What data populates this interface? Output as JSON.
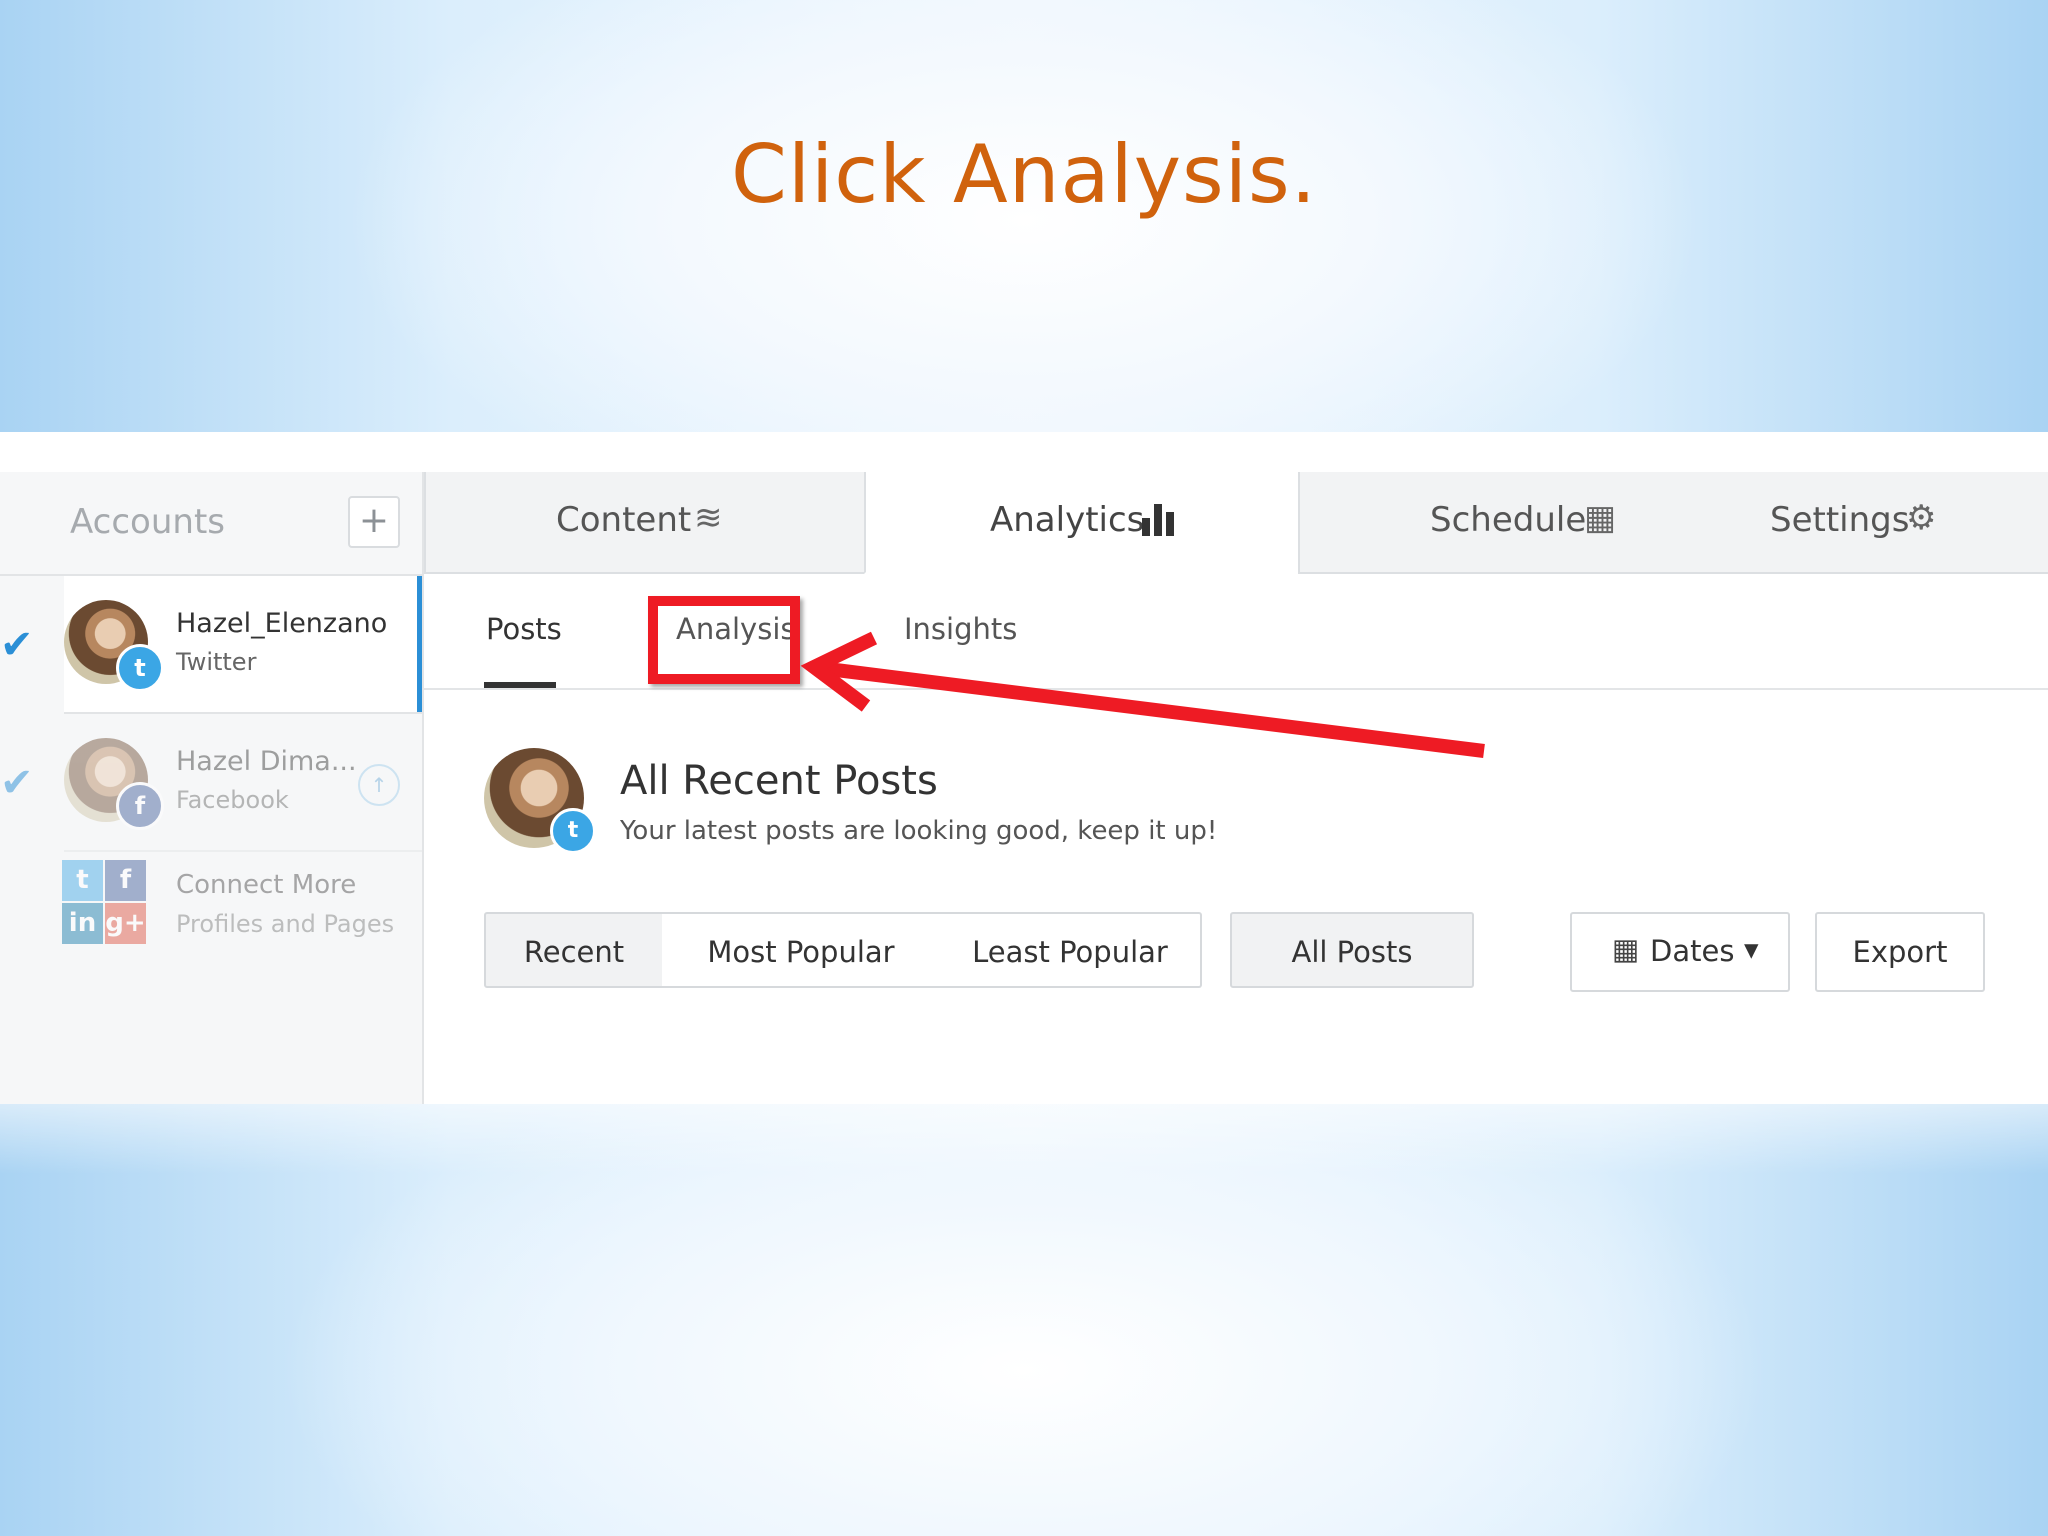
{
  "slide": {
    "instruction": "Click Analysis."
  },
  "sidebar": {
    "header_label": "Accounts",
    "add_symbol": "+",
    "accounts": [
      {
        "name": "Hazel_Elenzano",
        "network": "Twitter",
        "badge": "t",
        "selected": true
      },
      {
        "name": "Hazel Dima...",
        "network": "Facebook",
        "badge": "f",
        "selected": true
      }
    ],
    "check_symbol": "✔",
    "info_symbol": "↑",
    "connect": {
      "line1": "Connect More",
      "line2": "Profiles and Pages",
      "tiles": [
        "t",
        "f",
        "in",
        "g+"
      ]
    }
  },
  "top_tabs": [
    {
      "label": "Content",
      "icon": "layers-icon",
      "glyph": "≋"
    },
    {
      "label": "Analytics",
      "icon": "bar-chart-icon",
      "glyph": "▮"
    },
    {
      "label": "Schedule",
      "icon": "calendar-icon",
      "glyph": "▦"
    },
    {
      "label": "Settings",
      "icon": "gear-icon",
      "glyph": "⚙"
    }
  ],
  "active_top_tab": "Analytics",
  "sub_tabs": [
    {
      "label": "Posts"
    },
    {
      "label": "Analysis"
    },
    {
      "label": "Insights"
    }
  ],
  "feed": {
    "title": "All Recent Posts",
    "subtitle": "Your latest posts are looking good, keep it up!",
    "badge": "t"
  },
  "filters": {
    "sort": [
      "Recent",
      "Most Popular",
      "Least Popular"
    ],
    "scope": "All Posts",
    "dates": "Dates",
    "dates_icon": "▦",
    "caret": "▾",
    "export": "Export"
  },
  "colors": {
    "title": "#d0620d",
    "accent": "#2b8fd6",
    "highlight": "#ee1b24",
    "twitter": "#3ba6e5",
    "facebook": "#3b5998",
    "linkedin": "#0e76a8",
    "googleplus": "#dd4b39"
  }
}
